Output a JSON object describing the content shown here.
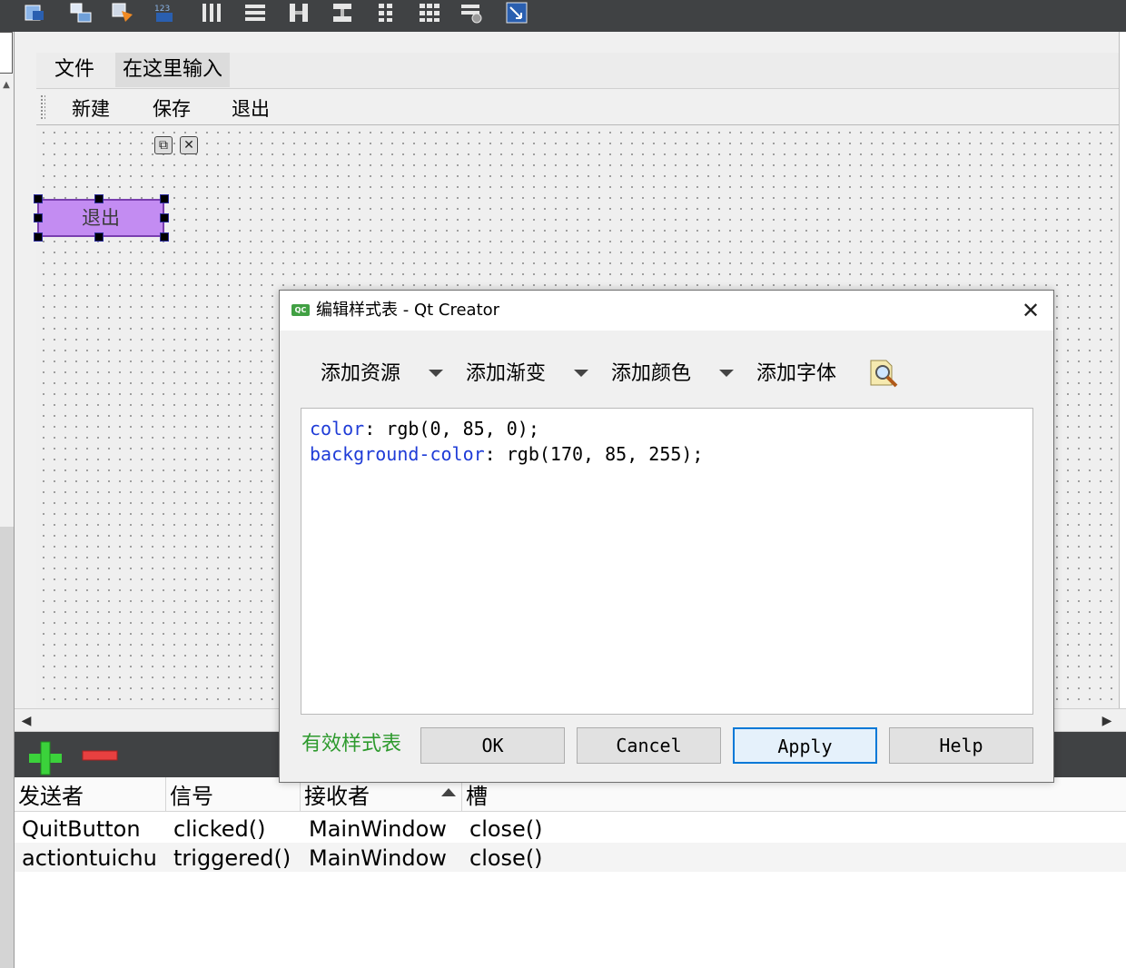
{
  "menubar": {
    "file_label": "文件",
    "type_here_label": "在这里输入"
  },
  "subbar": {
    "new_label": "新建",
    "save_label": "保存",
    "quit_label": "退出"
  },
  "form": {
    "quit_button_label": "退出",
    "quit_button_bg": "#c38cf2"
  },
  "dialog": {
    "title": "编辑样式表 - Qt Creator",
    "tools": {
      "add_resource": "添加资源",
      "add_gradient": "添加渐变",
      "add_color": "添加颜色",
      "add_font": "添加字体"
    },
    "editor": {
      "line1_prop": "color",
      "line1_value": ": rgb(0, 85, 0);",
      "line2_prop": "background-color",
      "line2_value": ": rgb(170, 85, 255);"
    },
    "valid_label": "有效样式表",
    "buttons": {
      "ok": "OK",
      "cancel": "Cancel",
      "apply": "Apply",
      "help": "Help"
    }
  },
  "signal_slot": {
    "headers": {
      "sender": "发送者",
      "signal": "信号",
      "receiver": "接收者",
      "slot": "槽"
    },
    "rows": [
      {
        "sender": "QuitButton",
        "signal": "clicked()",
        "receiver": "MainWindow",
        "slot": "close()"
      },
      {
        "sender": "actiontuichu",
        "signal": "triggered()",
        "receiver": "MainWindow",
        "slot": "close()"
      }
    ]
  },
  "colors": {
    "toolbar_dark": "#404244",
    "accent": "#0078d7",
    "valid_green": "#2e9a2e",
    "css_prop_blue": "#1f3cd7"
  }
}
